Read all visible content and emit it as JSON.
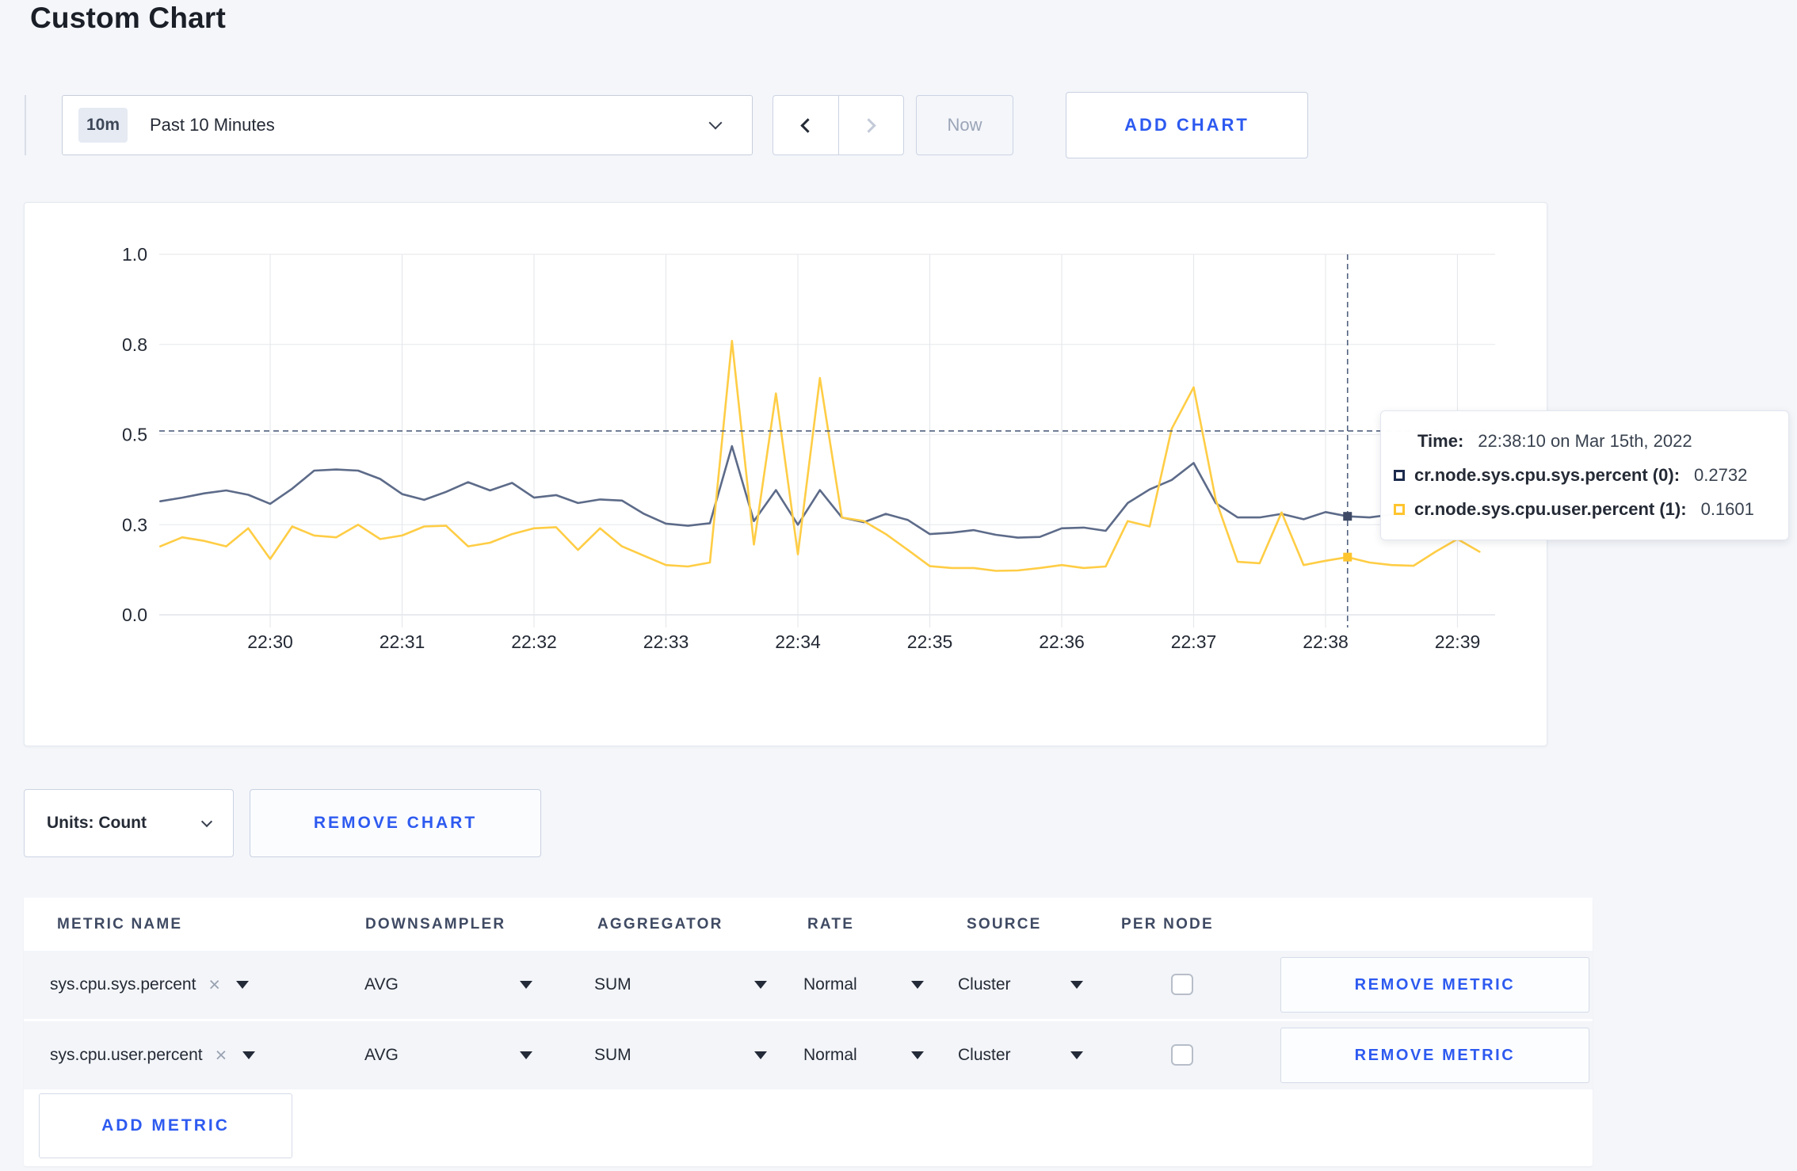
{
  "page": {
    "title": "Custom Chart",
    "accent_blue": "#2d5af0",
    "background": "#f4f6fa"
  },
  "icons": {
    "close_x": "×"
  },
  "toolbar": {
    "range_badge": "10m",
    "range_label": "Past 10 Minutes",
    "now_label": "Now",
    "add_chart_label": "ADD CHART"
  },
  "tooltip": {
    "time_label": "Time:",
    "time_value": "22:38:10 on Mar 15th, 2022",
    "series": [
      {
        "name": "cr.node.sys.cpu.sys.percent (0):",
        "value": "0.2732",
        "swatch_color": "#1c2a4d"
      },
      {
        "name": "cr.node.sys.cpu.user.percent (1):",
        "value": "0.1601",
        "swatch_color": "#ffc52e"
      }
    ]
  },
  "chart_controls": {
    "units_label": "Units: Count",
    "remove_chart_label": "REMOVE CHART"
  },
  "chart_data": {
    "type": "line",
    "title": "",
    "xlabel": "",
    "ylabel": "",
    "grid": true,
    "legend_position": "tooltip-only",
    "ylim": [
      0,
      1.0
    ],
    "y_tick_values": [
      0,
      0.25,
      0.5,
      0.75,
      1.0
    ],
    "y_tick_labels": [
      "0.0",
      "0.3",
      "0.5",
      "0.8",
      "1.0"
    ],
    "x_tick_labels": [
      "22:30",
      "22:31",
      "22:32",
      "22:33",
      "22:34",
      "22:35",
      "22:36",
      "22:37",
      "22:38",
      "22:39"
    ],
    "x_start": "22:29:10",
    "x_interval_seconds": 10,
    "crosshair": {
      "x": "22:38:10",
      "y_value": 0.51
    },
    "highlight_markers": [
      {
        "series": 0,
        "value": 0.2732,
        "fill": "#3e4a66"
      },
      {
        "series": 1,
        "value": 0.1601,
        "fill": "#ffc52e"
      }
    ],
    "series": [
      {
        "name": "cr.node.sys.cpu.sys.percent (0)",
        "color": "#5d6b89",
        "values": [
          0.315,
          0.325,
          0.337,
          0.345,
          0.333,
          0.308,
          0.35,
          0.4,
          0.403,
          0.4,
          0.377,
          0.335,
          0.319,
          0.341,
          0.368,
          0.345,
          0.366,
          0.325,
          0.332,
          0.31,
          0.32,
          0.317,
          0.28,
          0.253,
          0.247,
          0.254,
          0.468,
          0.26,
          0.346,
          0.25,
          0.346,
          0.27,
          0.257,
          0.28,
          0.263,
          0.224,
          0.228,
          0.235,
          0.222,
          0.214,
          0.216,
          0.24,
          0.242,
          0.233,
          0.31,
          0.348,
          0.374,
          0.421,
          0.31,
          0.27,
          0.27,
          0.28,
          0.265,
          0.285,
          0.2732,
          0.27,
          0.278,
          0.272,
          0.268,
          0.275,
          0.3
        ]
      },
      {
        "name": "cr.node.sys.cpu.user.percent (1)",
        "color": "#ffcd45",
        "values": [
          0.19,
          0.215,
          0.205,
          0.19,
          0.24,
          0.155,
          0.245,
          0.22,
          0.215,
          0.25,
          0.21,
          0.22,
          0.245,
          0.247,
          0.19,
          0.2,
          0.224,
          0.24,
          0.243,
          0.18,
          0.24,
          0.19,
          0.164,
          0.138,
          0.134,
          0.145,
          0.76,
          0.195,
          0.614,
          0.168,
          0.657,
          0.27,
          0.26,
          0.224,
          0.18,
          0.135,
          0.13,
          0.13,
          0.122,
          0.123,
          0.13,
          0.138,
          0.13,
          0.134,
          0.26,
          0.245,
          0.516,
          0.631,
          0.32,
          0.147,
          0.143,
          0.284,
          0.138,
          0.15,
          0.1601,
          0.145,
          0.138,
          0.136,
          0.175,
          0.21,
          0.175
        ]
      }
    ]
  },
  "metrics_table": {
    "headers": [
      "METRIC NAME",
      "DOWNSAMPLER",
      "AGGREGATOR",
      "RATE",
      "SOURCE",
      "PER NODE"
    ],
    "rows": [
      {
        "metric": "sys.cpu.sys.percent",
        "downsampler": "AVG",
        "aggregator": "SUM",
        "rate": "Normal",
        "source": "Cluster",
        "per_node_checked": false,
        "remove_label": "REMOVE METRIC"
      },
      {
        "metric": "sys.cpu.user.percent",
        "downsampler": "AVG",
        "aggregator": "SUM",
        "rate": "Normal",
        "source": "Cluster",
        "per_node_checked": false,
        "remove_label": "REMOVE METRIC"
      }
    ],
    "add_metric_label": "ADD METRIC"
  }
}
